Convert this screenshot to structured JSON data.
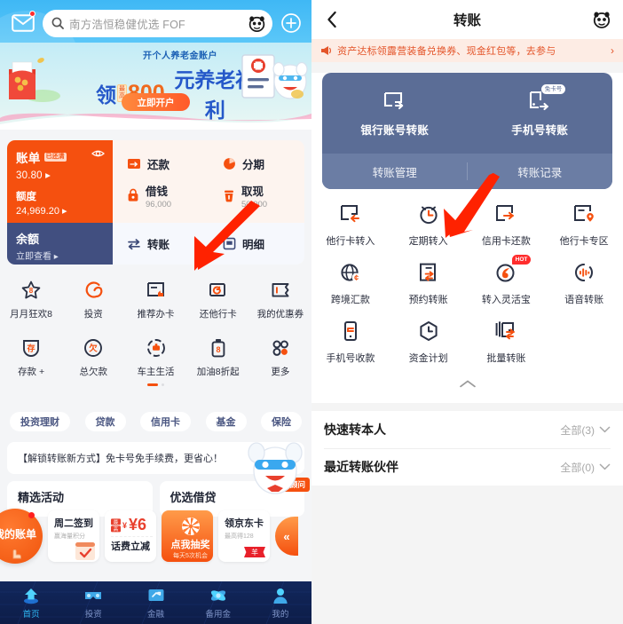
{
  "left": {
    "topbar": {
      "mail_icon": "mail-icon",
      "plus_icon": "plus-icon",
      "search_placeholder": "南方浩恒稳健优选 FOF",
      "search_value": "南方浩恒稳健优选 FOF",
      "joy_icon": "joy-face-icon"
    },
    "banner": {
      "subtitle": "开个人养老金账户",
      "main_prefix": "领",
      "main_chip": "最高",
      "main_amount": "800",
      "main_suffix": "元养老福利",
      "cta": "立即开户"
    },
    "account_card": {
      "bill_label": "账单",
      "bill_badge": "已还清",
      "bill_value": "30.80 ▸",
      "limit_label": "额度",
      "limit_value": "24,969.20 ▸",
      "balance_label": "余额",
      "balance_sub": "立即查看 ▸",
      "actions": [
        {
          "label": "还款",
          "sub": "",
          "icon": "repay-icon"
        },
        {
          "label": "分期",
          "sub": "",
          "icon": "installment-icon"
        },
        {
          "label": "借钱",
          "sub": "96,000",
          "icon": "borrow-icon"
        },
        {
          "label": "取现",
          "sub": "50,000",
          "icon": "cash-out-icon"
        },
        {
          "label": "转账",
          "sub": "",
          "icon": "transfer-icon"
        },
        {
          "label": "明细",
          "sub": "",
          "icon": "detail-icon"
        }
      ]
    },
    "grid": [
      {
        "label": "月月狂欢8",
        "icon": "star-8-icon"
      },
      {
        "label": "投资",
        "icon": "invest-swirl-icon"
      },
      {
        "label": "推荐办卡",
        "icon": "recommend-card-icon"
      },
      {
        "label": "还他行卡",
        "icon": "repay-other-card-icon"
      },
      {
        "label": "我的优惠券",
        "icon": "coupon-icon"
      },
      {
        "label": "存款 +",
        "icon": "deposit-shield-icon"
      },
      {
        "label": "总欠款",
        "icon": "total-debt-icon"
      },
      {
        "label": "车主生活",
        "icon": "car-life-icon"
      },
      {
        "label": "加油8折起",
        "icon": "fuel-icon"
      },
      {
        "label": "更多",
        "icon": "more-dots-icon"
      }
    ],
    "pills": [
      "投资理财",
      "贷款",
      "信用卡",
      "基金",
      "保险"
    ],
    "promo": {
      "text": "【解锁转账新方式】免卡号免手续费，更省心！",
      "adviser_badge": "专属顾问",
      "dog_icon": "joy-dog-icon"
    },
    "sections": [
      {
        "title": "精选活动"
      },
      {
        "title": "优选借贷"
      }
    ],
    "float_cards": {
      "circle": "我的账单",
      "items": [
        {
          "title": "周二签到",
          "sub": "赢海量积分",
          "icon": "calendar-check-icon",
          "style": "white"
        },
        {
          "title": "¥6",
          "sub": "话费立减",
          "icon": "max-tag-icon",
          "style": "white"
        },
        {
          "title": "点我抽奖",
          "sub": "每天5次机会",
          "icon": "lottery-wheel-icon",
          "style": "orange"
        },
        {
          "title": "领京东卡",
          "sub": "最高得128",
          "icon": "jd-card-icon",
          "style": "white"
        }
      ],
      "arrow_label": "«"
    },
    "bottom_nav": [
      {
        "label": "首页",
        "icon": "home-icon",
        "active": true
      },
      {
        "label": "投资",
        "icon": "invest-icon",
        "active": false
      },
      {
        "label": "金融",
        "icon": "finance-icon",
        "active": false
      },
      {
        "label": "备用金",
        "icon": "reserve-fund-icon",
        "active": false
      },
      {
        "label": "我的",
        "icon": "profile-icon",
        "active": false
      }
    ]
  },
  "right": {
    "header": {
      "back_icon": "back-chevron-icon",
      "title": "转账",
      "joy_icon": "joy-face-icon"
    },
    "notice": {
      "icon": "megaphone-icon",
      "text": "资产达标领露营装备兑换券、现金红包等，去参与",
      "chevron": "›"
    },
    "blue_card": {
      "top": [
        {
          "label": "银行账号转账",
          "icon": "bank-account-transfer-icon",
          "chip": ""
        },
        {
          "label": "手机号转账",
          "icon": "phone-transfer-icon",
          "chip": "免卡号"
        }
      ],
      "bottom": [
        "转账管理",
        "转账记录"
      ]
    },
    "grid": [
      {
        "label": "他行卡转入",
        "icon": "other-card-in-icon",
        "hot": false
      },
      {
        "label": "定期转入",
        "icon": "scheduled-deposit-icon",
        "hot": false
      },
      {
        "label": "信用卡还款",
        "icon": "credit-card-repay-icon",
        "hot": false
      },
      {
        "label": "他行卡专区",
        "icon": "other-card-zone-icon",
        "hot": false
      },
      {
        "label": "跨境汇款",
        "icon": "cross-border-icon",
        "hot": false
      },
      {
        "label": "预约转账",
        "icon": "booking-transfer-icon",
        "hot": false
      },
      {
        "label": "转入灵活宝",
        "icon": "flexible-treasure-icon",
        "hot": true,
        "hot_label": "HOT"
      },
      {
        "label": "语音转账",
        "icon": "voice-transfer-icon",
        "hot": false
      },
      {
        "label": "手机号收款",
        "icon": "phone-receive-icon",
        "hot": false
      },
      {
        "label": "资金计划",
        "icon": "fund-plan-icon",
        "hot": false
      },
      {
        "label": "批量转账",
        "icon": "batch-transfer-icon",
        "hot": false
      }
    ],
    "collapse_icon": "chevron-up-icon",
    "lists": [
      {
        "title": "快速转本人",
        "right": "全部(3)",
        "chevron": "chevron-down-icon"
      },
      {
        "title": "最近转账伙伴",
        "right": "全部(0)",
        "chevron": "chevron-down-icon"
      }
    ]
  },
  "annotations": {
    "arrow_color": "#FF2200",
    "arrows": [
      {
        "name": "arrow-to-transfer",
        "target": "转账"
      },
      {
        "name": "arrow-to-scheduled-deposit",
        "target": "定期转入"
      }
    ]
  },
  "colors": {
    "brand_orange": "#F5500F",
    "brand_blue": "#414F80",
    "sky_blue": "#3FB8F5",
    "card_blue": "#5B6D96",
    "notice_bg": "#FDECE4",
    "notice_text": "#E4552A"
  }
}
